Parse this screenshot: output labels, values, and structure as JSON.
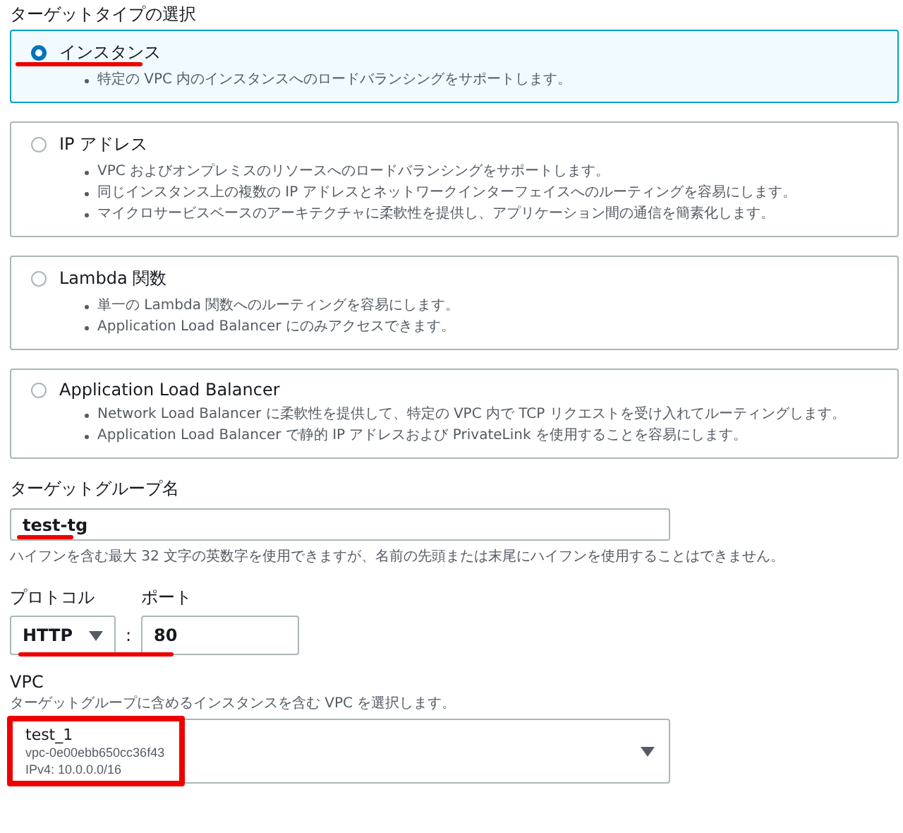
{
  "target_type": {
    "label": "ターゲットタイプの選択",
    "options": [
      {
        "title": "インスタンス",
        "selected": true,
        "underlined": true,
        "bullets": [
          "特定の VPC 内のインスタンスへのロードバランシングをサポートします。"
        ]
      },
      {
        "title": "IP アドレス",
        "selected": false,
        "underlined": false,
        "bullets": [
          "VPC およびオンプレミスのリソースへのロードバランシングをサポートします。",
          "同じインスタンス上の複数の IP アドレスとネットワークインターフェイスへのルーティングを容易にします。",
          "マイクロサービスベースのアーキテクチャに柔軟性を提供し、アプリケーション間の通信を簡素化します。"
        ]
      },
      {
        "title": "Lambda 関数",
        "selected": false,
        "underlined": false,
        "bullets": [
          "単一の Lambda 関数へのルーティングを容易にします。",
          "Application Load Balancer にのみアクセスできます。"
        ]
      },
      {
        "title": "Application Load Balancer",
        "selected": false,
        "underlined": false,
        "bullets": [
          "Network Load Balancer に柔軟性を提供して、特定の VPC 内で TCP リクエストを受け入れてルーティングします。",
          "Application Load Balancer で静的 IP アドレスおよび PrivateLink を使用することを容易にします。"
        ]
      }
    ]
  },
  "group_name": {
    "label": "ターゲットグループ名",
    "value": "test-tg",
    "underlined": true,
    "help": "ハイフンを含む最大 32 文字の英数字を使用できますが、名前の先頭または末尾にハイフンを使用することはできません。"
  },
  "protocol": {
    "label": "プロトコル",
    "value": "HTTP",
    "separator": ":",
    "port_label": "ポート",
    "port_value": "80",
    "underlined": true
  },
  "vpc": {
    "label": "VPC",
    "help": "ターゲットグループに含めるインスタンスを含む VPC を選択します。",
    "name": "test_1",
    "id": "vpc-0e00ebb650cc36f43",
    "cidr": "IPv4: 10.0.0.0/16",
    "boxed": true
  }
}
